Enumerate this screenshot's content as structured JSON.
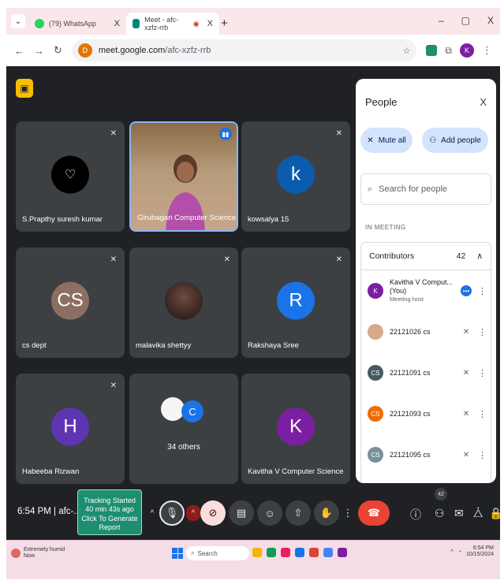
{
  "tabs": [
    {
      "label": "(79) WhatsApp",
      "color": "#25d366"
    },
    {
      "label": "Meet - afc-xzfz-rrb",
      "color": "#00897b"
    }
  ],
  "address": {
    "domain": "meet.google.com",
    "path": "/afc-xzfz-rrb",
    "site_letter": "D"
  },
  "profile_letter": "K",
  "tiles": [
    {
      "name": "S.Prapthy suresh kumar",
      "initial": "♡",
      "color": "#000000"
    },
    {
      "name": "Girubagari Computer Science",
      "initial": "",
      "color": ""
    },
    {
      "name": "kowsalya 15",
      "initial": "k",
      "color": "#0b5cad"
    },
    {
      "name": "cs dept",
      "initial": "CS",
      "color": "#8d6e63"
    },
    {
      "name": "malavika shettyy",
      "initial": "",
      "color": "#3e2723"
    },
    {
      "name": "Rakshaya Sree",
      "initial": "R",
      "color": "#1a73e8"
    },
    {
      "name": "Habeeba Rizwan",
      "initial": "H",
      "color": "#5e35b1"
    },
    {
      "name": "34 others",
      "initial": "C",
      "color": "#1a73e8"
    },
    {
      "name": "Kavitha V Computer Science",
      "initial": "K",
      "color": "#7b1fa2"
    }
  ],
  "people": {
    "title": "People",
    "close": "X",
    "mute_all": "Mute all",
    "add_people": "Add people",
    "search_placeholder": "Search for people",
    "in_meeting": "IN MEETING",
    "contributors_label": "Contributors",
    "contributors_count": "42",
    "list": [
      {
        "name": "Kavitha V Comput... (You)",
        "role": "Meeting host",
        "initial": "K",
        "color": "#7b1fa2"
      },
      {
        "name": "22121026 cs",
        "role": "",
        "initial": "",
        "color": "#d7a98c"
      },
      {
        "name": "22121091 cs",
        "role": "",
        "initial": "CS",
        "color": "#455a64"
      },
      {
        "name": "22121093 cs",
        "role": "",
        "initial": "CS",
        "color": "#ef6c00"
      },
      {
        "name": "22121095 cs",
        "role": "",
        "initial": "CS",
        "color": "#78909c"
      }
    ]
  },
  "toolbar": {
    "clock": "6:54 PM | afc-...",
    "tracking_line1": "Tracking Started",
    "tracking_line2": "40 min 43s ago",
    "tracking_line3": "Click To Generate Report",
    "people_badge": "42"
  },
  "taskbar": {
    "weather_line1": "Extremely humid",
    "weather_line2": "Now",
    "search": "Search",
    "time": "6:54 PM",
    "date": "10/15/2024"
  }
}
